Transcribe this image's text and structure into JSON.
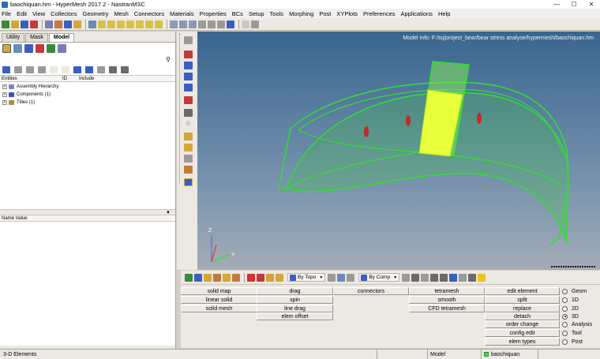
{
  "window": {
    "title": "baochiquan.hm - HyperMesh 2017.2 - NastranMSC",
    "controls": [
      "—",
      "☐",
      "✕"
    ]
  },
  "menu": [
    "File",
    "Edit",
    "View",
    "Collectors",
    "Geometry",
    "Mesh",
    "Connectors",
    "Materials",
    "Properties",
    "BCs",
    "Setup",
    "Tools",
    "Morphing",
    "Post",
    "XYPlots",
    "Preferences",
    "Applications",
    "Help"
  ],
  "browser": {
    "tabs": [
      "Utility",
      "Mask",
      "Model"
    ],
    "active_tab": "Model",
    "filter_icon": "⚲",
    "columns": {
      "entities": "Entities",
      "id": "ID",
      "include": "Include"
    },
    "tree": [
      {
        "label": "Assembly Hierarchy",
        "color": "#8a7dbf"
      },
      {
        "label": "Components (1)",
        "color": "#3b4fbf"
      },
      {
        "label": "Titles (1)",
        "color": "#b58a3a"
      }
    ],
    "splitter_arrow": "▼",
    "prop_header": "Name Value"
  },
  "viewport": {
    "model_info": "Model Info: F:/tsj/project_bear/bear stress analyse/hypermesh/baochiquan.hm",
    "axes": {
      "x": "Y",
      "y": "Z"
    }
  },
  "bottom_toolbar": {
    "topo_label": "By Topo",
    "comp_label": "By Comp"
  },
  "panel": {
    "col1": [
      "solid map",
      "linear solid",
      "solid mesh"
    ],
    "col2": [
      "drag",
      "spin",
      "line drag",
      "elem offset"
    ],
    "col3": [
      "connectors"
    ],
    "col4": [
      "tetramesh",
      "smooth",
      "CFD tetramesh"
    ],
    "col5": [
      "edit element",
      "split",
      "replace",
      "detach",
      "order change",
      "config edit",
      "elem types"
    ],
    "radios": [
      "Geom",
      "1D",
      "2D",
      "3D",
      "Analysis",
      "Tool",
      "Post"
    ],
    "selected_radio": "3D"
  },
  "status": {
    "left": "3-D Elements",
    "model": "Model",
    "component": "baochiquan"
  },
  "colors": {
    "accent_green": "#2fe02f",
    "highlight_yellow": "#e6ff3a",
    "viewport_top": "#39658f",
    "viewport_bottom": "#a3acb6"
  }
}
